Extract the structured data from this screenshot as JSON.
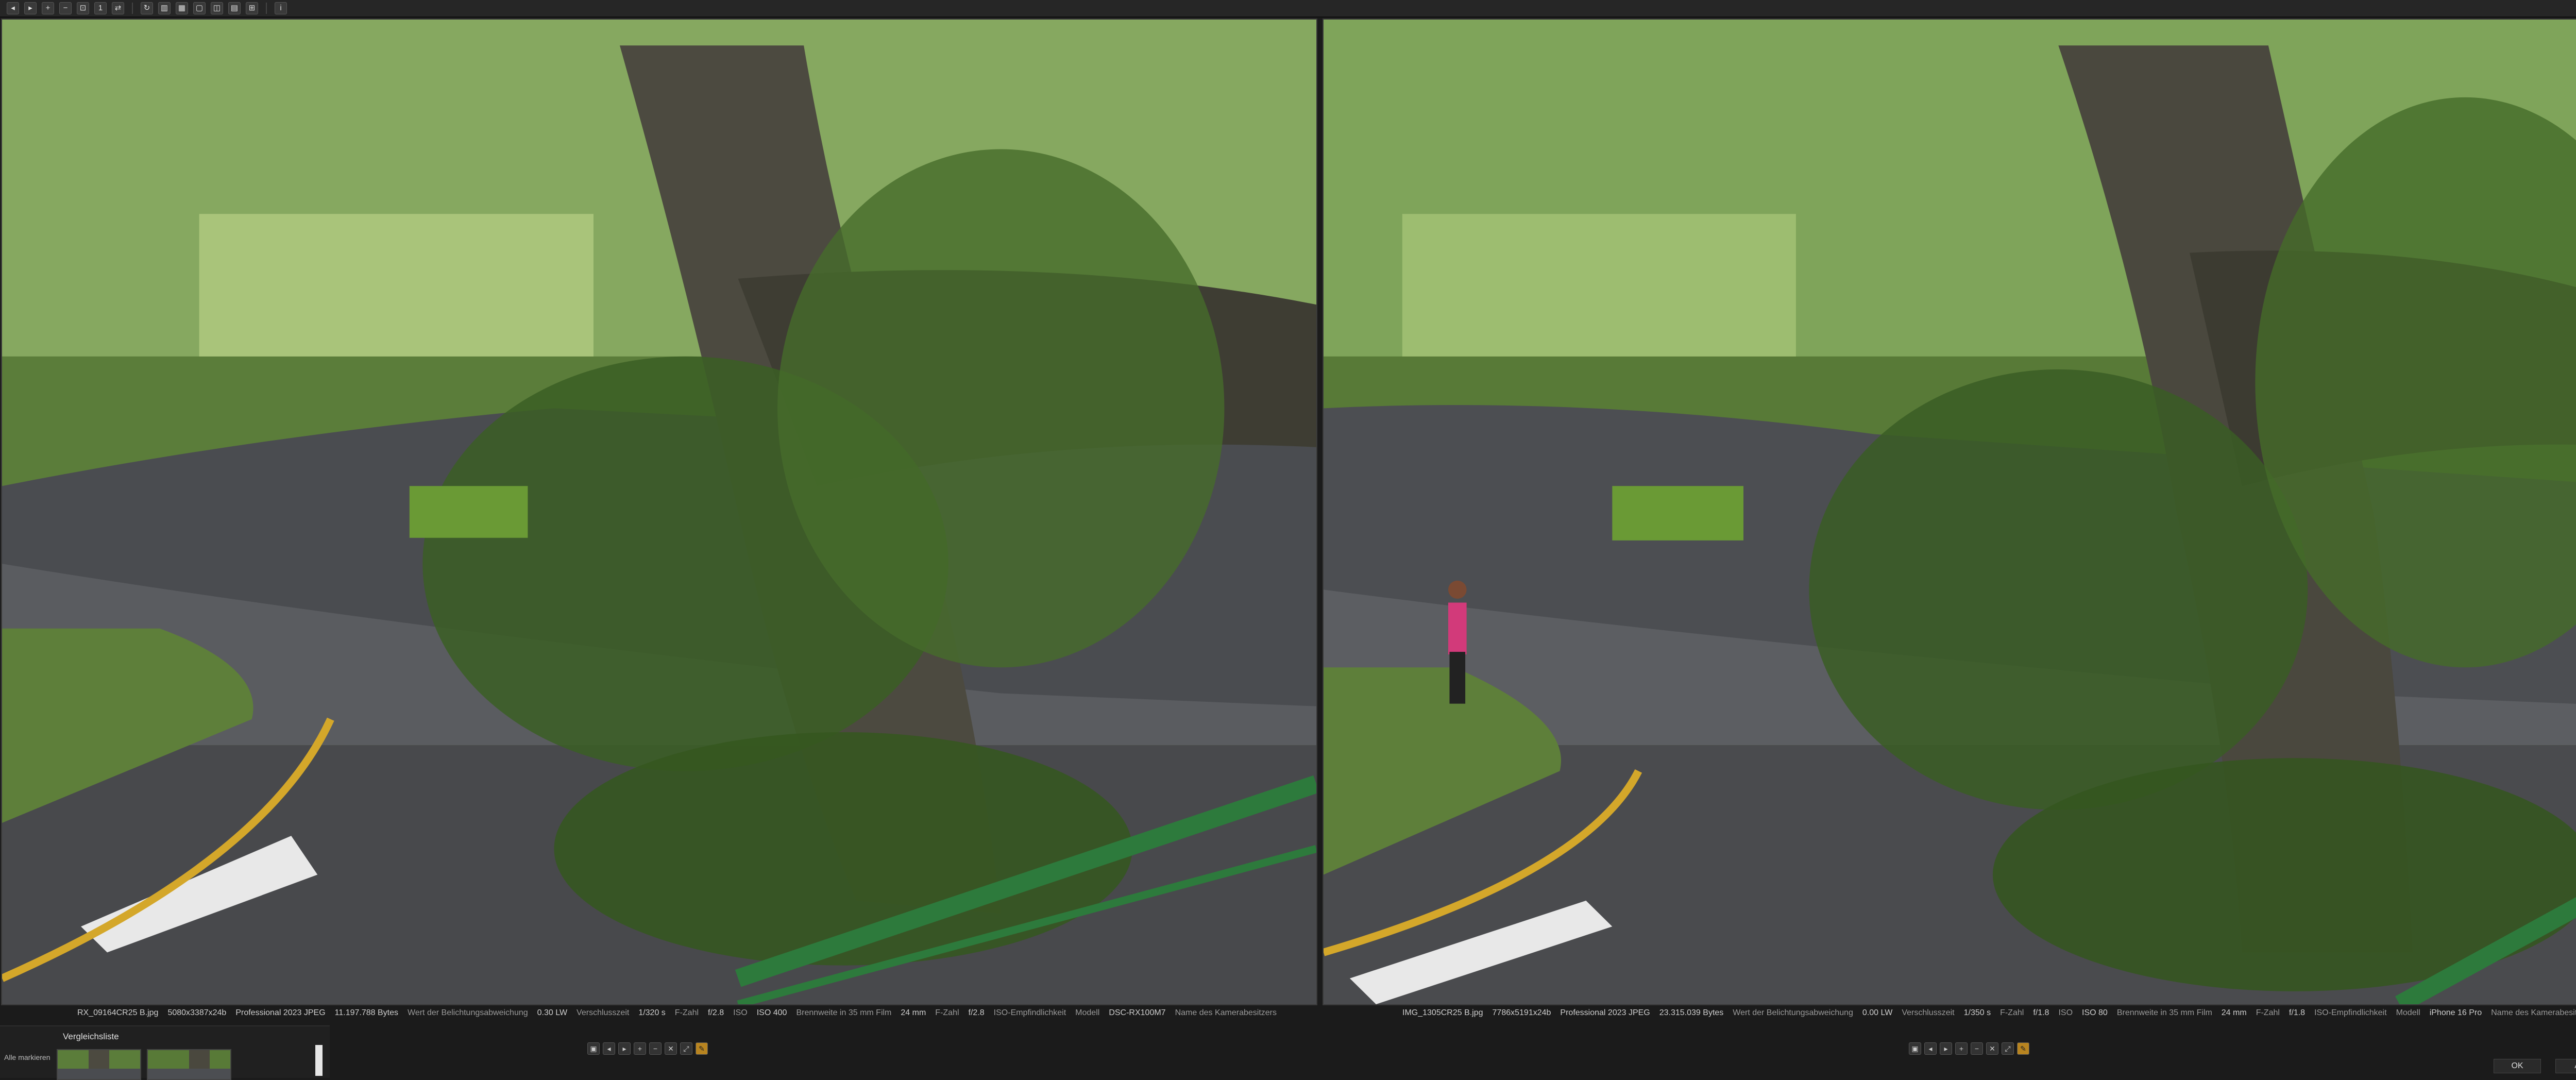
{
  "left_photo": {
    "filename": "RX_09164CR25 B.jpg",
    "dimensions": "5080x3387x24b",
    "format": "Professional 2023 JPEG",
    "filesize": "11.197.788 Bytes",
    "exposure_bias_label": "Wert der Belichtungsabweichung",
    "exposure_bias": "0.30 LW",
    "shutter_label": "Verschlusszeit",
    "shutter": "1/320 s",
    "fnumber_label": "F-Zahl",
    "fnumber": "f/2.8",
    "iso_label": "ISO",
    "iso": "ISO 400",
    "focal35_label": "Brennweite in 35 mm Film",
    "focal35": "24 mm",
    "fnumber2_label": "F-Zahl",
    "fnumber2": "f/2.8",
    "iso_sens_label": "ISO-Empfindlichkeit",
    "model_label": "Modell",
    "model": "DSC-RX100M7",
    "camera_owner_label": "Name des Kamerabesitzers"
  },
  "right_photo": {
    "filename": "IMG_1305CR25 B.jpg",
    "dimensions": "7786x5191x24b",
    "format": "Professional 2023 JPEG",
    "filesize": "23.315.039 Bytes",
    "exposure_bias_label": "Wert der Belichtungsabweichung",
    "exposure_bias": "0.00 LW",
    "shutter_label": "Verschlusszeit",
    "shutter": "1/350 s",
    "fnumber_label": "F-Zahl",
    "fnumber": "f/1.8",
    "iso_label": "ISO",
    "iso": "ISO 80",
    "focal35_label": "Brennweite in 35 mm Film",
    "focal35": "24 mm",
    "fnumber2_label": "F-Zahl",
    "fnumber2": "f/1.8",
    "iso_sens_label": "ISO-Empfindlichkeit",
    "model_label": "Modell",
    "model": "iPhone 16 Pro",
    "camera_owner_label": "Name des Kamerabesitzers"
  },
  "compare_panel": {
    "title": "Vergleichsliste",
    "select_all": "Alle markieren"
  },
  "dialog": {
    "ok": "OK",
    "cancel": "Abbrechen"
  },
  "toolbar_icons": [
    "circle-icon",
    "circle-icon",
    "zoom-in-icon",
    "zoom-out-icon",
    "zoom-fit-icon",
    "zoom-100-icon",
    "sync-icon",
    "rotate-icon",
    "histogram-icon",
    "grid-icon",
    "image-icon",
    "image-icon",
    "image-icon",
    "image-icon",
    "compare-icon",
    "info-icon"
  ],
  "colors": {
    "background": "#1b1b1b",
    "toolbar": "#262626",
    "warn_button": "#b88420"
  }
}
